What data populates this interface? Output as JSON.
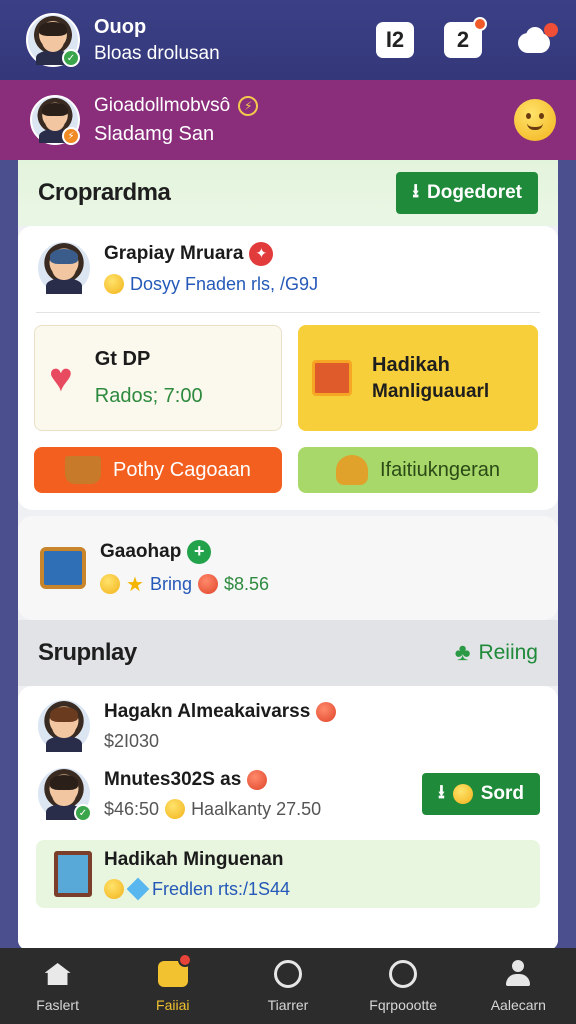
{
  "topbar": {
    "title": "Ouop",
    "subtitle": "Bloas drolusan",
    "counter_a": "I2",
    "counter_b": "2",
    "icons": [
      "avatar",
      "calendar-icon",
      "notification-icon",
      "cloud-icon"
    ]
  },
  "profile_bar": {
    "name": "Gioadollmobvsô",
    "subtitle": "Sladamg San",
    "icons": [
      "avatar",
      "bolt-icon",
      "smiley-icon"
    ]
  },
  "section1": {
    "title": "Croprardma",
    "button_label": "Dogedoret",
    "button_icon": "download-icon",
    "user": {
      "name": "Grapiay Mruara",
      "detail": "Dosyy Fnaden rls, /G9J",
      "icons": [
        "avatar",
        "red-circle-icon",
        "smiley-icon"
      ]
    },
    "tiles": {
      "t1_title": "Gt DP",
      "t1_sub": "Rados; 7:00",
      "t2_title": "Hadikah",
      "t2_sub": "Manliguauarl",
      "t3_label": "Pothy Cagoaan",
      "t4_label": "Ifaitiukngeran"
    }
  },
  "gift_card": {
    "name": "Gaaohap",
    "detail_a": "Bring",
    "detail_b": "$8.56",
    "icons": [
      "chest-icon",
      "green-plus-icon",
      "coins-icon",
      "star-icon",
      "smiley-icon"
    ]
  },
  "section2": {
    "title": "Srupnlay",
    "link_label": "Reiing",
    "link_icon": "clover-icon",
    "rows": [
      {
        "name": "Hagakn Almeakaivarss",
        "detail": "$2I030"
      },
      {
        "name": "Mnutes302S as",
        "detail_a": "$46:50",
        "detail_b": "Haalkanty 27.50",
        "button_label": "Sord"
      },
      {
        "name": "Hadikah Minguenan",
        "detail": "Fredlen rts:/1S44"
      }
    ]
  },
  "bottom_nav": [
    {
      "label": "Faslert",
      "icon": "home-icon",
      "active": false
    },
    {
      "label": "Faiiai",
      "icon": "bag-icon",
      "active": true
    },
    {
      "label": "Tiarrer",
      "icon": "search-off-icon",
      "active": false
    },
    {
      "label": "Fqrpoootte",
      "icon": "compass-icon",
      "active": false
    },
    {
      "label": "Aalecarn",
      "icon": "user-icon",
      "active": false
    }
  ],
  "colors": {
    "header": "#3b3f86",
    "profile_bar": "#8a2e7c",
    "primary_green": "#1f8a3a",
    "orange_tile": "#f25f1f",
    "yellow_tile": "#f7cf3a",
    "lime_tile": "#a8d86a",
    "nav_bg": "#2c2c2c",
    "nav_active": "#f2c230"
  }
}
